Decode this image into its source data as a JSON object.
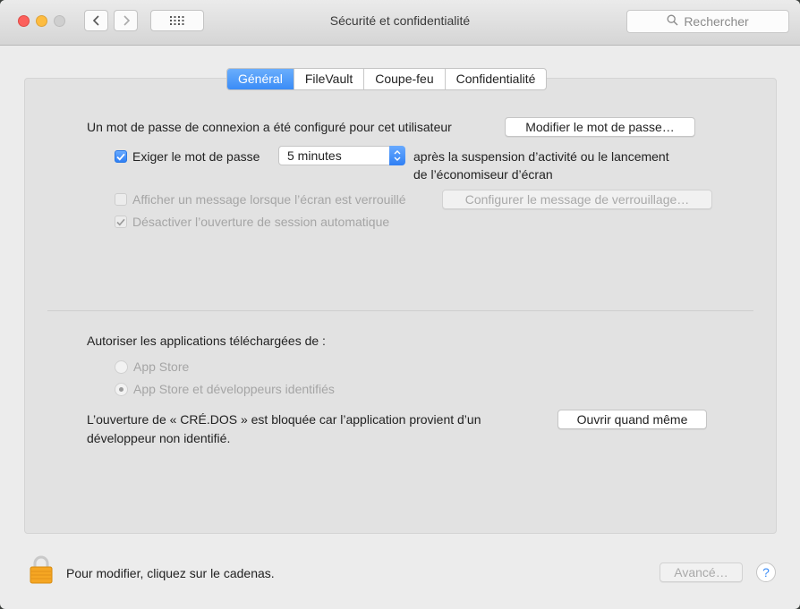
{
  "window": {
    "title": "Sécurité et confidentialité"
  },
  "search": {
    "placeholder": "Rechercher"
  },
  "tabs": [
    {
      "label": "Général",
      "active": true
    },
    {
      "label": "FileVault",
      "active": false
    },
    {
      "label": "Coupe-feu",
      "active": false
    },
    {
      "label": "Confidentialité",
      "active": false
    }
  ],
  "general": {
    "password_set_text": "Un mot de passe de connexion a été configuré pour cet utilisateur",
    "change_password_button": "Modifier le mot de passe…",
    "require_password": {
      "label": "Exiger le mot de passe",
      "checked": true
    },
    "delay_select": {
      "value": "5 minutes"
    },
    "after_sleep_line1": "après la suspension d’activité ou le lancement",
    "after_sleep_line2": "de l’économiseur d’écran",
    "show_message": {
      "label": "Afficher un message lorsque l’écran est verrouillé",
      "checked": false,
      "enabled": false
    },
    "set_lock_message_button": "Configurer le message de verrouillage…",
    "disable_auto_login": {
      "label": "Désactiver l’ouverture de session automatique",
      "checked": true,
      "enabled": false
    }
  },
  "downloads": {
    "heading": "Autoriser les applications téléchargées de :",
    "options": [
      {
        "label": "App Store",
        "selected": false
      },
      {
        "label": "App Store et développeurs identifiés",
        "selected": true
      }
    ],
    "blocked_line1": "L’ouverture de « CRÉ.DOS » est bloquée car l’application provient d’un",
    "blocked_line2": "développeur non identifié.",
    "open_anyway_button": "Ouvrir quand même"
  },
  "footer": {
    "lock_text": "Pour modifier, cliquez sur le cadenas.",
    "advanced_button": "Avancé…",
    "help_button": "?"
  },
  "colors": {
    "accent": "#3a8cf7",
    "lock": "#f5a623"
  }
}
